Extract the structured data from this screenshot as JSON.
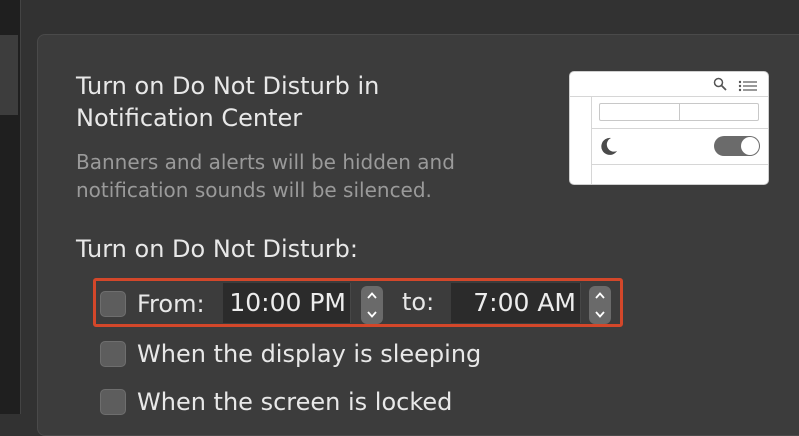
{
  "panel": {
    "title": "Turn on Do Not Disturb in Notification Center",
    "description": "Banners and alerts will be hidden and notification sounds will be silenced."
  },
  "schedule": {
    "section_label": "Turn on Do Not Disturb:",
    "from_label": "From:",
    "from_time": "10:00 PM",
    "to_label": "to:",
    "to_time": "7:00 AM",
    "from_checked": false,
    "options": [
      {
        "label": "When the display is sleeping",
        "checked": false
      },
      {
        "label": "When the screen is locked",
        "checked": false
      }
    ]
  },
  "colors": {
    "highlight": "#d3472a",
    "background": "#323232",
    "panel": "#3c3c3c"
  }
}
